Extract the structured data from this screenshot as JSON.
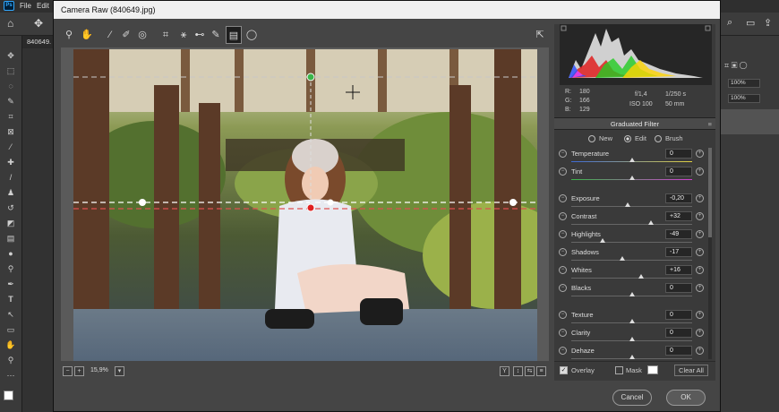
{
  "ps": {
    "menu": [
      "File",
      "Edit"
    ],
    "logo": "Ps",
    "doc_tab": "840649.",
    "zoom_pct_1": "100%",
    "zoom_pct_2": "100%"
  },
  "cr": {
    "title": "Camera Raw (840649.jpg)",
    "tools": [
      "zoom-icon",
      "hand-icon",
      "white-balance-icon",
      "color-sampler-icon",
      "targeted-adjust-icon",
      "crop-icon",
      "straighten-icon",
      "red-eye-icon",
      "adjustment-brush-icon",
      "graduated-filter-icon",
      "radial-filter-icon"
    ],
    "zoom_level": "15,9%",
    "status_icons": [
      "Y",
      "↕",
      "⇆",
      "≡"
    ],
    "cancel": "Cancel",
    "ok": "OK"
  },
  "readout": {
    "r_label": "R:",
    "r": "180",
    "g_label": "G:",
    "g": "166",
    "b_label": "B:",
    "b": "129",
    "aperture": "f/1,4",
    "shutter": "1/250 s",
    "iso": "ISO 100",
    "focal": "50 mm"
  },
  "filter": {
    "title": "Graduated Filter",
    "modes": [
      "New",
      "Edit",
      "Brush"
    ],
    "selected_mode": "Edit"
  },
  "sliders": [
    {
      "label": "Temperature",
      "value": "0",
      "pos": 0.5,
      "track": "temp"
    },
    {
      "label": "Tint",
      "value": "0",
      "pos": 0.5,
      "track": "tint"
    },
    {
      "label": "Exposure",
      "value": "-0,20",
      "pos": 0.47,
      "track": "gray"
    },
    {
      "label": "Contrast",
      "value": "+32",
      "pos": 0.66,
      "track": "gray"
    },
    {
      "label": "Highlights",
      "value": "-49",
      "pos": 0.26,
      "track": "gray"
    },
    {
      "label": "Shadows",
      "value": "-17",
      "pos": 0.42,
      "track": "gray"
    },
    {
      "label": "Whites",
      "value": "+16",
      "pos": 0.58,
      "track": "gray"
    },
    {
      "label": "Blacks",
      "value": "0",
      "pos": 0.5,
      "track": "gray"
    },
    {
      "label": "Texture",
      "value": "0",
      "pos": 0.5,
      "track": "gray"
    },
    {
      "label": "Clarity",
      "value": "0",
      "pos": 0.5,
      "track": "gray"
    },
    {
      "label": "Dehaze",
      "value": "0",
      "pos": 0.5,
      "track": "gray"
    }
  ],
  "panel_bottom": {
    "overlay": "Overlay",
    "overlay_checked": true,
    "mask": "Mask",
    "mask_checked": false,
    "clear_all": "Clear All"
  }
}
